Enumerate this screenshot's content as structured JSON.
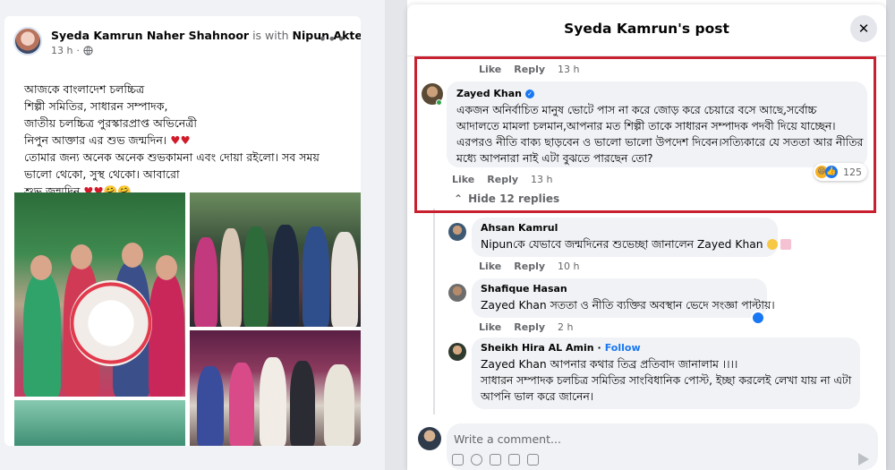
{
  "post": {
    "author": "Syeda Kamrun Naher Shahnoor",
    "with_text": "is with",
    "tagged": "Nipun Akter.",
    "time": "13 h",
    "privacy_icon": "globe-icon",
    "lines": [
      "আজকে  বাংলাদেশ চলচ্চিত্র",
      " শিল্পী সমিতির, সাধারন সম্পাদক,",
      "জাতীয় চলচ্চিত্র পুরস্কারপ্রাপ্ত  অভিনেত্রী",
      "নিপুন আক্তার  এর শুভ জন্মদিন।",
      "তোমার জন্য  অনেক অনেক শুভকামনা  এবং দোয়া রইলো। সব সময়",
      "ভালো থেকো, সুস্থ থেকো। আবারো",
      "শুভ জন্মদিন"
    ],
    "heart_emoji": "♥♥",
    "hug_emoji": "🤗🤗"
  },
  "modal": {
    "title": "Syeda Kamrun's post",
    "close_icon": "close-icon"
  },
  "top_actions": {
    "like": "Like",
    "reply": "Reply",
    "time": "13 h"
  },
  "main_comment": {
    "name": "Zayed Khan",
    "lines": [
      "একজন অনির্বাচিত মানুষ ভোটে পাস না করে জোড় করে চেয়ারে বসে আছে,সর্বোচ্চ",
      "আদালতে মামলা চলমান,আপনার মত শিল্পী তাকে সাধারন সম্পাদক পদবী দিয়ে যাচ্ছেন।",
      "এরপরও নীতি বাক্য ছাড়বেন ও ভালো ভালো উপদেশ দিবেন।সত্যিকারে যে সততা আর নীতির",
      "মধ্যে আপনারা নাই এটা বুঝতে পারছেন তো?"
    ],
    "like": "Like",
    "reply": "Reply",
    "time": "13 h",
    "reaction_count": "125",
    "hide_replies": "Hide 12 replies"
  },
  "replies": [
    {
      "name": "Ahsan Kamrul",
      "text_tag": "Nipun",
      "text": "কে যেভাবে জন্মদিনের শুভেচ্ছা জানালেন Zayed Khan",
      "like": "Like",
      "reply": "Reply",
      "time": "10 h"
    },
    {
      "name": "Shafique Hasan",
      "text_tag": "Zayed Khan",
      "text": " সততা ও নীতি ব্যক্তির অবস্থান ভেদে সংজ্ঞা পাল্টায়।",
      "like": "Like",
      "reply": "Reply",
      "time": "2 h"
    },
    {
      "name": "Sheikh Hira AL Amin",
      "follow": "Follow",
      "text_tag": "Zayed Khan",
      "line1": " আপনার কথার তিব্র প্রতিবাদ জানালাম ।।।।",
      "line2": "সাধারন সম্পাদক চলচিত্র সমিতির সাংবিধানিক পোস্ট, ইচ্ছা করলেই লেখা যায় না এটা",
      "line3": "আপনি ভাল করে জানেন।"
    }
  ],
  "composer": {
    "placeholder": "Write a comment..."
  },
  "colors": {
    "accent": "#1877f2",
    "highlight": "#c8202f",
    "bubble": "#f0f2f5"
  }
}
